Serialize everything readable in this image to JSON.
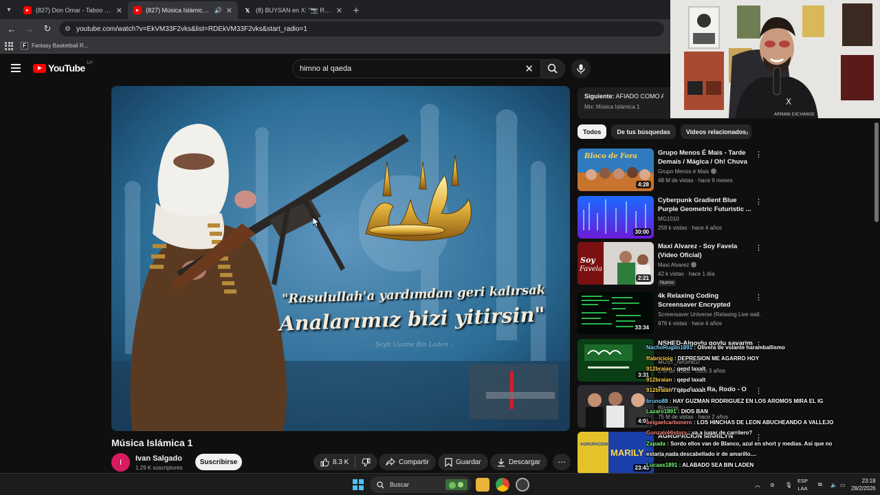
{
  "browser": {
    "tabs": [
      {
        "title": "(827) Don Omar - Taboo - YouTube",
        "icon": "youtube-icon",
        "active": false
      },
      {
        "title": "(827) Música Islámica 1 - YouTube",
        "icon": "youtube-icon",
        "active": true
      },
      {
        "title": "(8) BUYSAN en X: \"📷 Raúl Giu…",
        "icon": "x-icon",
        "active": false
      }
    ],
    "url": "youtube.com/watch?v=EkVM33F2vks&list=RDEkVM33F2vks&start_radio=1",
    "bookmarks": [
      {
        "label": "Fantasy Basketball R...",
        "icon": "fantasy-f-logo"
      }
    ]
  },
  "youtube": {
    "logo_text": "YouTube",
    "country_code": "UY",
    "search": {
      "value": "himno al qaeda"
    },
    "video": {
      "overlay_line1": "\"Rasulullah'a yardımdan geri kalırsak",
      "overlay_line2": "Analarımız bizi yitirsin\"",
      "overlay_attrib": "- Şeyh Usame Bin Laden -",
      "title": "Música Islámica 1",
      "channel": "Ivan Salgado",
      "channel_initial": "I",
      "subscribers": "1.29 K suscriptores",
      "subscribe_label": "Suscribirse",
      "likes": "8.3 K",
      "share_label": "Compartir",
      "save_label": "Guardar",
      "download_label": "Descargar"
    },
    "up_next": {
      "label": "Siguiente:",
      "title": "AFIADO COMO A ESPADA",
      "playlist": "Mix: Música Islámica 1"
    },
    "chips": [
      {
        "label": "Todos",
        "active": true
      },
      {
        "label": "De tus búsquedas",
        "active": false
      },
      {
        "label": "Videos relacionados",
        "active": false
      }
    ],
    "recommendations": [
      {
        "title": "Grupo Menos É Mais - Tarde Demais / Mágica / Oh! Chuva ...",
        "channel": "Grupo Menos é Mais",
        "verified": true,
        "meta": "48 M de vistas · hace 9 meses",
        "duration": "4:28",
        "badge": ""
      },
      {
        "title": "Cyberpunk Gradient Blue Purple Geometric Futuristic ...",
        "channel": "MG1010",
        "verified": false,
        "meta": "259 k vistas · hace 4 años",
        "duration": "30:00",
        "badge": ""
      },
      {
        "title": "Maxi Alvarez - Soy Favela (Video Oficial)",
        "channel": "Maxi Alvarez",
        "verified": true,
        "meta": "42 k vistas · hace 1 día",
        "duration": "2:21",
        "badge": "Nuevo"
      },
      {
        "title": "4k Relaxing Coding Screensaver Encrypted Programming Code ...",
        "channel": "Screensaver Universe (Relaxing Live wall...",
        "verified": false,
        "meta": "976 k vistas · hace 4 años",
        "duration": "33:34",
        "badge": ""
      },
      {
        "title": "NSHED-Alqovlu qoylu savarim",
        "channel": "MOST_NASHED",
        "verified": false,
        "meta": "3 M de vistas · hace 3 años",
        "duration": "3:31",
        "badge": ""
      },
      {
        "title": "Bizarrap - Luck Ra, Rodo - O",
        "channel": "Bizarrap",
        "verified": false,
        "meta": "75 M de vistas · hace 2 años",
        "duration": "4:01",
        "badge": ""
      },
      {
        "title": "AGRUPACION MARILYN",
        "channel": "Zapada en vivo",
        "verified": false,
        "meta": "",
        "duration": "23:45",
        "badge": ""
      }
    ]
  },
  "chat": [
    {
      "user": "NachoRugilo1891",
      "text": "Olivera de volante haramballismo",
      "color": "c3"
    },
    {
      "user": "ffabricioig",
      "text": "DEPRESION ME AGARRO HOY",
      "color": "c1"
    },
    {
      "user": "912braian",
      "text": "qepd laxalt",
      "color": "c1"
    },
    {
      "user": "912braian",
      "text": "qepd laxalt",
      "color": "c1"
    },
    {
      "user": "912braian",
      "text": "qepd laxalt",
      "color": "c1"
    },
    {
      "user": "bruno88",
      "text": "HAY GUZMAN RODRIGUEZ EN LOS AROMOS MIRA EL IG",
      "color": "c3"
    },
    {
      "user": "Lazaro1891",
      "text": "DIOS BAN",
      "color": "c2"
    },
    {
      "user": "beigaelcarbonero",
      "text": "LOS HINCHAS DE LEON ABUCHEANDO A VALLEJO",
      "color": "c4"
    },
    {
      "user": "GonzaloHistory",
      "text": "va a jugar de carrilero?",
      "color": "c4"
    },
    {
      "user": "Zapada",
      "text": "Sordo ellos van de Blanco, azul en short y medias. Asi que no",
      "color": "c2"
    },
    {
      "user": "",
      "text": "estaría nada descabellado ir de amarillo....",
      "color": "c1"
    },
    {
      "user": "Lucaas1891",
      "text": "ALABADO SEA BIN LADEN",
      "color": "c2"
    }
  ],
  "taskbar": {
    "search_placeholder": "Buscar",
    "lang_line1": "ESP",
    "lang_line2": "LAA",
    "time": "23:18",
    "date": "28/2/2026"
  },
  "colors": {
    "accent": "#ff0000",
    "background": "#0f0f0f"
  }
}
